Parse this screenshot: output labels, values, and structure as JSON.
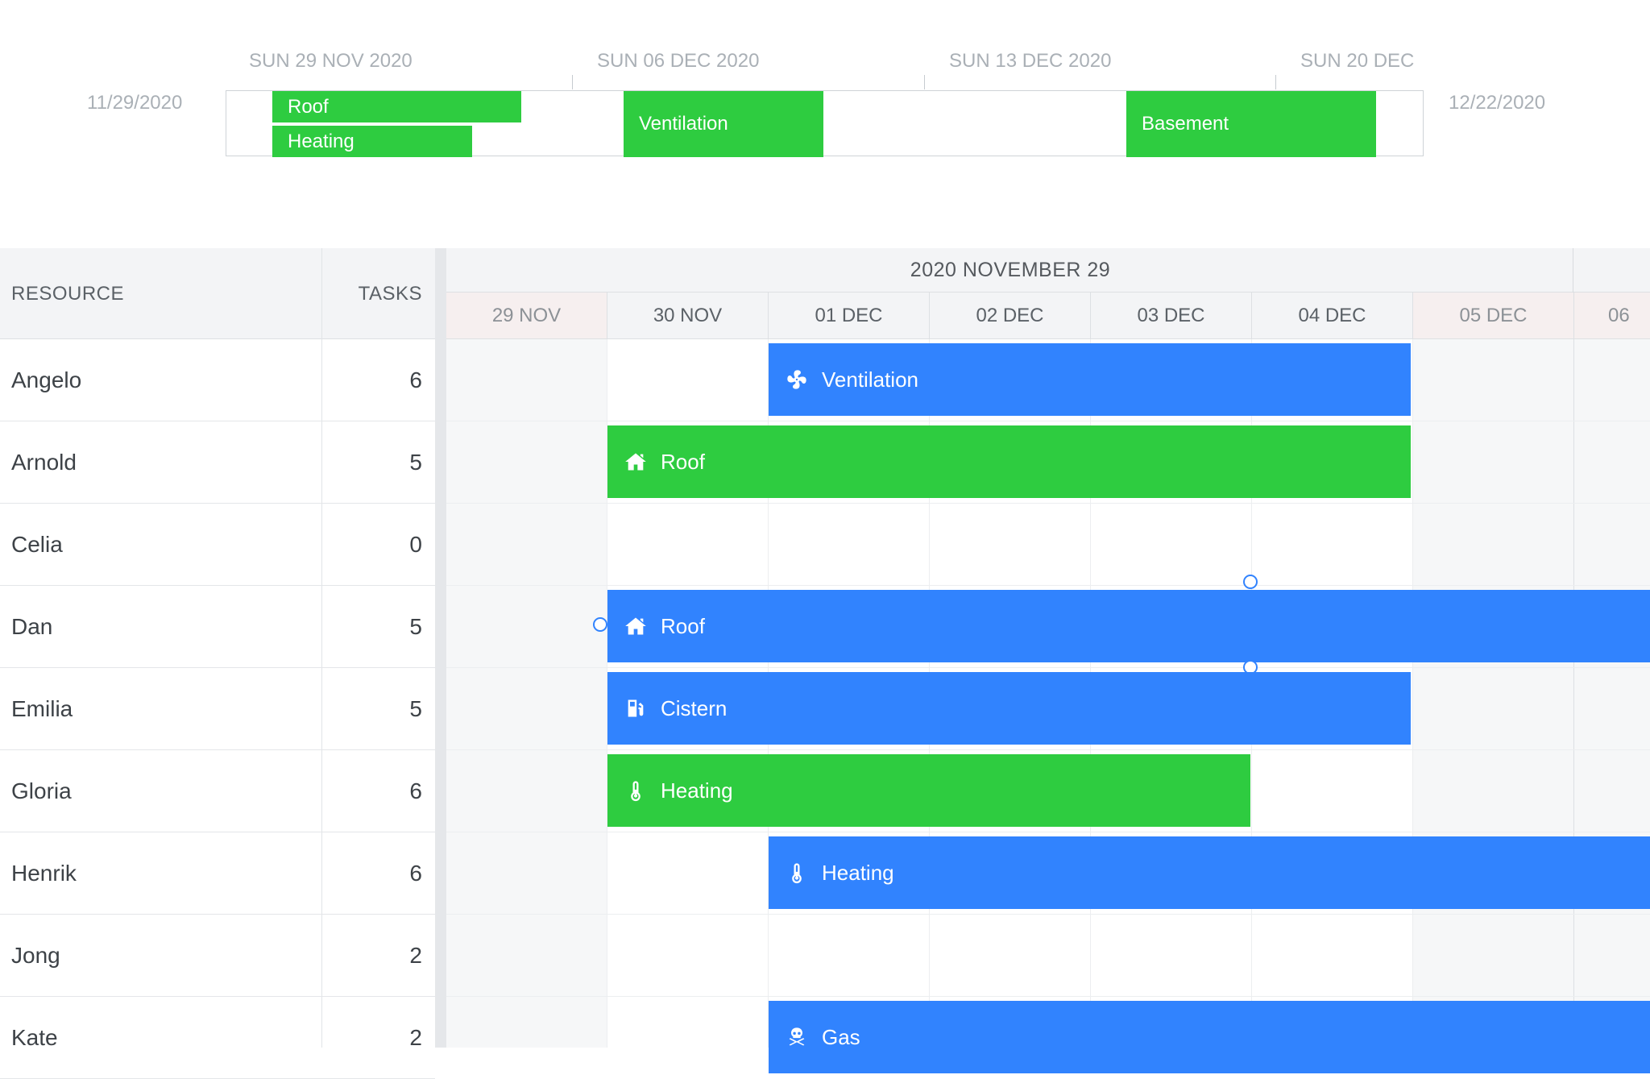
{
  "timeline": {
    "ticks": [
      "SUN 29 NOV 2020",
      "SUN 06 DEC 2020",
      "SUN 13 DEC 2020",
      "SUN 20 DEC"
    ],
    "start_date": "11/29/2020",
    "end_date": "12/22/2020",
    "events": [
      "Roof",
      "Heating",
      "Ventilation",
      "Basement"
    ]
  },
  "grid": {
    "columns": {
      "resource": "RESOURCE",
      "tasks": "TASKS"
    },
    "header_top": "2020 NOVEMBER 29",
    "days": [
      "29 NOV",
      "30 NOV",
      "01 DEC",
      "02 DEC",
      "03 DEC",
      "04 DEC",
      "05 DEC",
      "06"
    ],
    "rows": [
      {
        "name": "Angelo",
        "tasks": "6"
      },
      {
        "name": "Arnold",
        "tasks": "5"
      },
      {
        "name": "Celia",
        "tasks": "0"
      },
      {
        "name": "Dan",
        "tasks": "5"
      },
      {
        "name": "Emilia",
        "tasks": "5"
      },
      {
        "name": "Gloria",
        "tasks": "6"
      },
      {
        "name": "Henrik",
        "tasks": "6"
      },
      {
        "name": "Jong",
        "tasks": "2"
      },
      {
        "name": "Kate",
        "tasks": "2"
      }
    ],
    "events": [
      {
        "name": "Ventilation",
        "icon": "fan-icon",
        "color": "#3183fe"
      },
      {
        "name": "Roof",
        "icon": "house-icon",
        "color": "#2ecc40"
      },
      {
        "name": "Roof",
        "icon": "house-icon",
        "color": "#3183fe"
      },
      {
        "name": "Cistern",
        "icon": "fuel-pump-icon",
        "color": "#3183fe"
      },
      {
        "name": "Heating",
        "icon": "thermometer-icon",
        "color": "#2ecc40"
      },
      {
        "name": "Heating",
        "icon": "thermometer-icon",
        "color": "#3183fe"
      },
      {
        "name": "Gas",
        "icon": "skull-crossbones-icon",
        "color": "#3183fe"
      }
    ]
  }
}
